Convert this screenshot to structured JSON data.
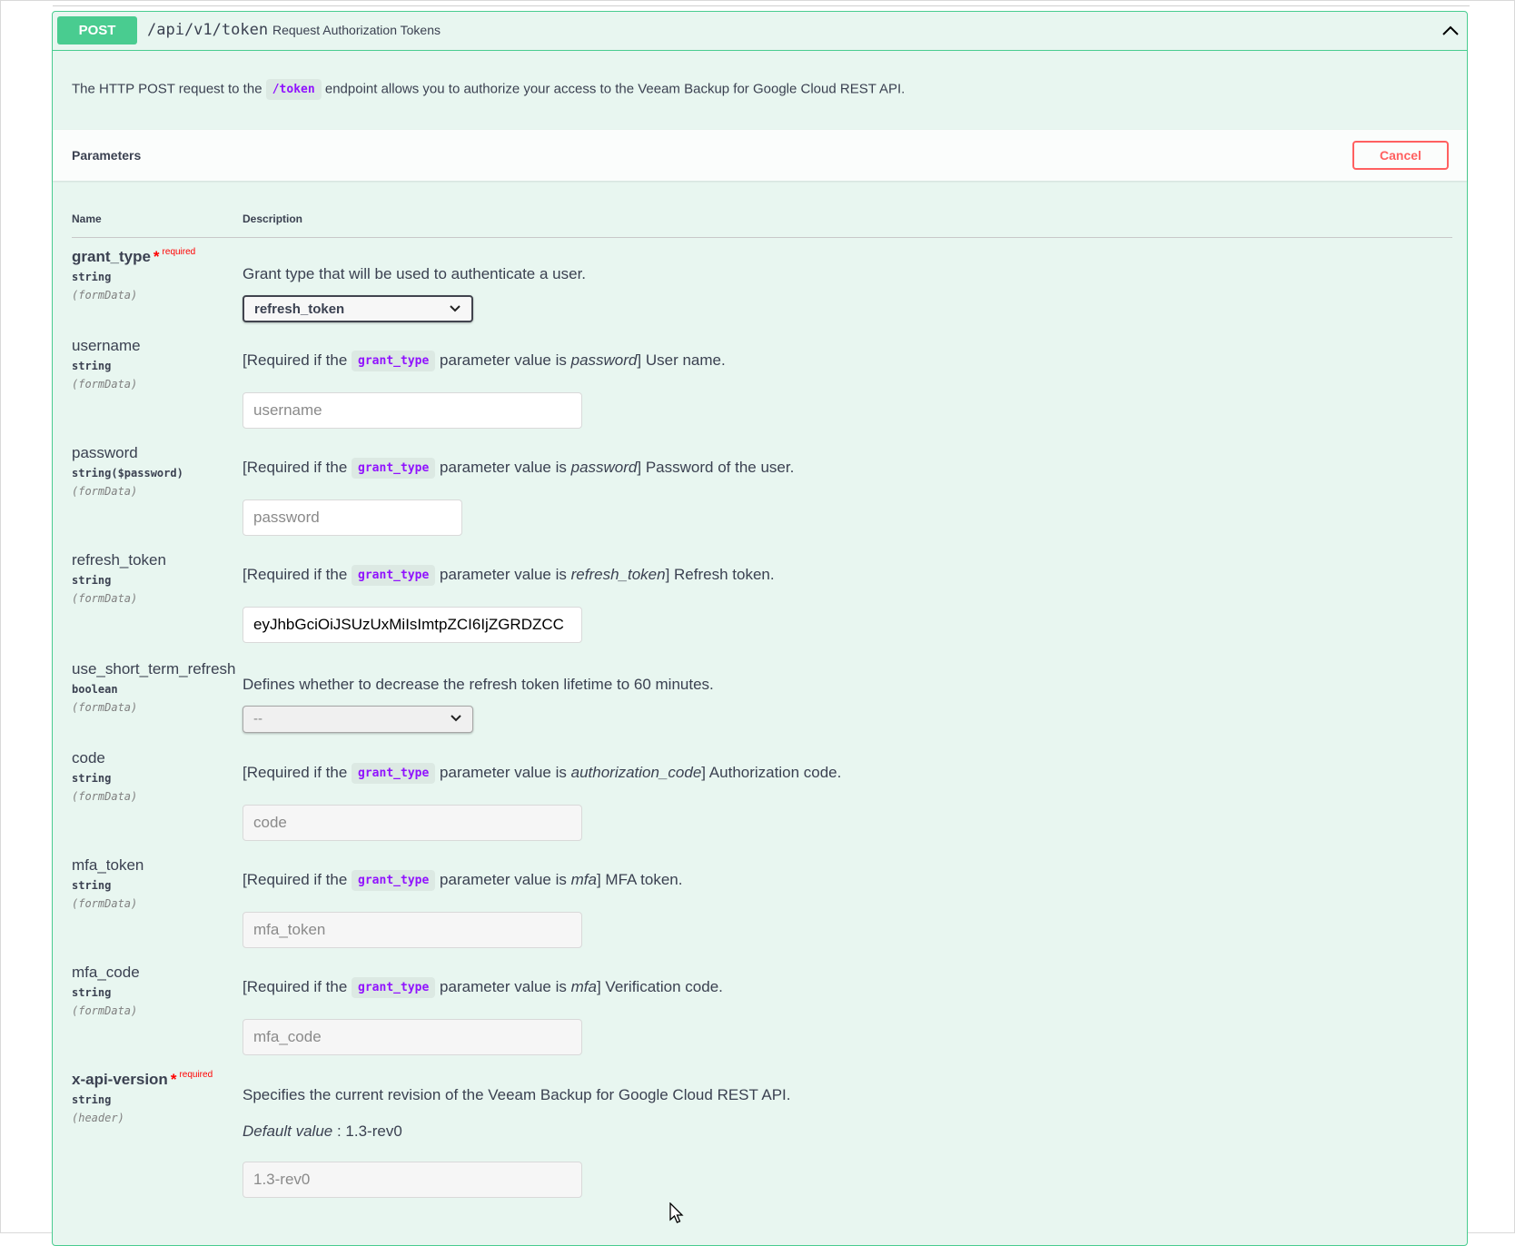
{
  "operation": {
    "method": "POST",
    "path": "/api/v1/token",
    "summary": "Request Authorization Tokens",
    "description_before": "The HTTP POST request to the",
    "description_code": "/token",
    "description_after": "endpoint allows you to authorize your access to the Veeam Backup for Google Cloud REST API."
  },
  "parameters_section": {
    "title": "Parameters",
    "cancel_label": "Cancel",
    "col_name": "Name",
    "col_description": "Description"
  },
  "common": {
    "required_if": "[Required if the",
    "grant_type_code": "grant_type",
    "param_value_is": "parameter value is",
    "required_label": "required",
    "star": "*"
  },
  "params": {
    "grant_type": {
      "name": "grant_type",
      "type": "string",
      "in": "(formData)",
      "description": "Grant type that will be used to authenticate a user.",
      "selected": "refresh_token"
    },
    "username": {
      "name": "username",
      "type": "string",
      "in": "(formData)",
      "cond": "password",
      "tail": "] User name.",
      "placeholder": "username"
    },
    "password": {
      "name": "password",
      "type": "string($password)",
      "in": "(formData)",
      "cond": "password",
      "tail": "] Password of the user.",
      "placeholder": "password"
    },
    "refresh_token": {
      "name": "refresh_token",
      "type": "string",
      "in": "(formData)",
      "cond": "refresh_token",
      "tail": "] Refresh token.",
      "value": "eyJhbGciOiJSUzUxMiIsImtpZCI6IjZGRDZCC"
    },
    "use_short_term_refresh": {
      "name": "use_short_term_refresh",
      "type": "boolean",
      "in": "(formData)",
      "description": "Defines whether to decrease the refresh token lifetime to 60 minutes.",
      "selected": "--"
    },
    "code": {
      "name": "code",
      "type": "string",
      "in": "(formData)",
      "cond": "authorization_code",
      "tail": "] Authorization code.",
      "placeholder": "code"
    },
    "mfa_token": {
      "name": "mfa_token",
      "type": "string",
      "in": "(formData)",
      "cond": "mfa",
      "tail": "] MFA token.",
      "placeholder": "mfa_token"
    },
    "mfa_code": {
      "name": "mfa_code",
      "type": "string",
      "in": "(formData)",
      "cond": "mfa",
      "tail": "] Verification code.",
      "placeholder": "mfa_code"
    },
    "x_api_version": {
      "name": "x-api-version",
      "type": "string",
      "in": "(header)",
      "description": "Specifies the current revision of the Veeam Backup for Google Cloud REST API.",
      "default_label": "Default value",
      "default_value": ": 1.3-rev0",
      "placeholder": "1.3-rev0"
    }
  },
  "colors": {
    "post_green": "#49cc90",
    "block_bg": "#e8f6f0",
    "cancel_red": "#ff6060",
    "code_purple": "#9012fe"
  }
}
